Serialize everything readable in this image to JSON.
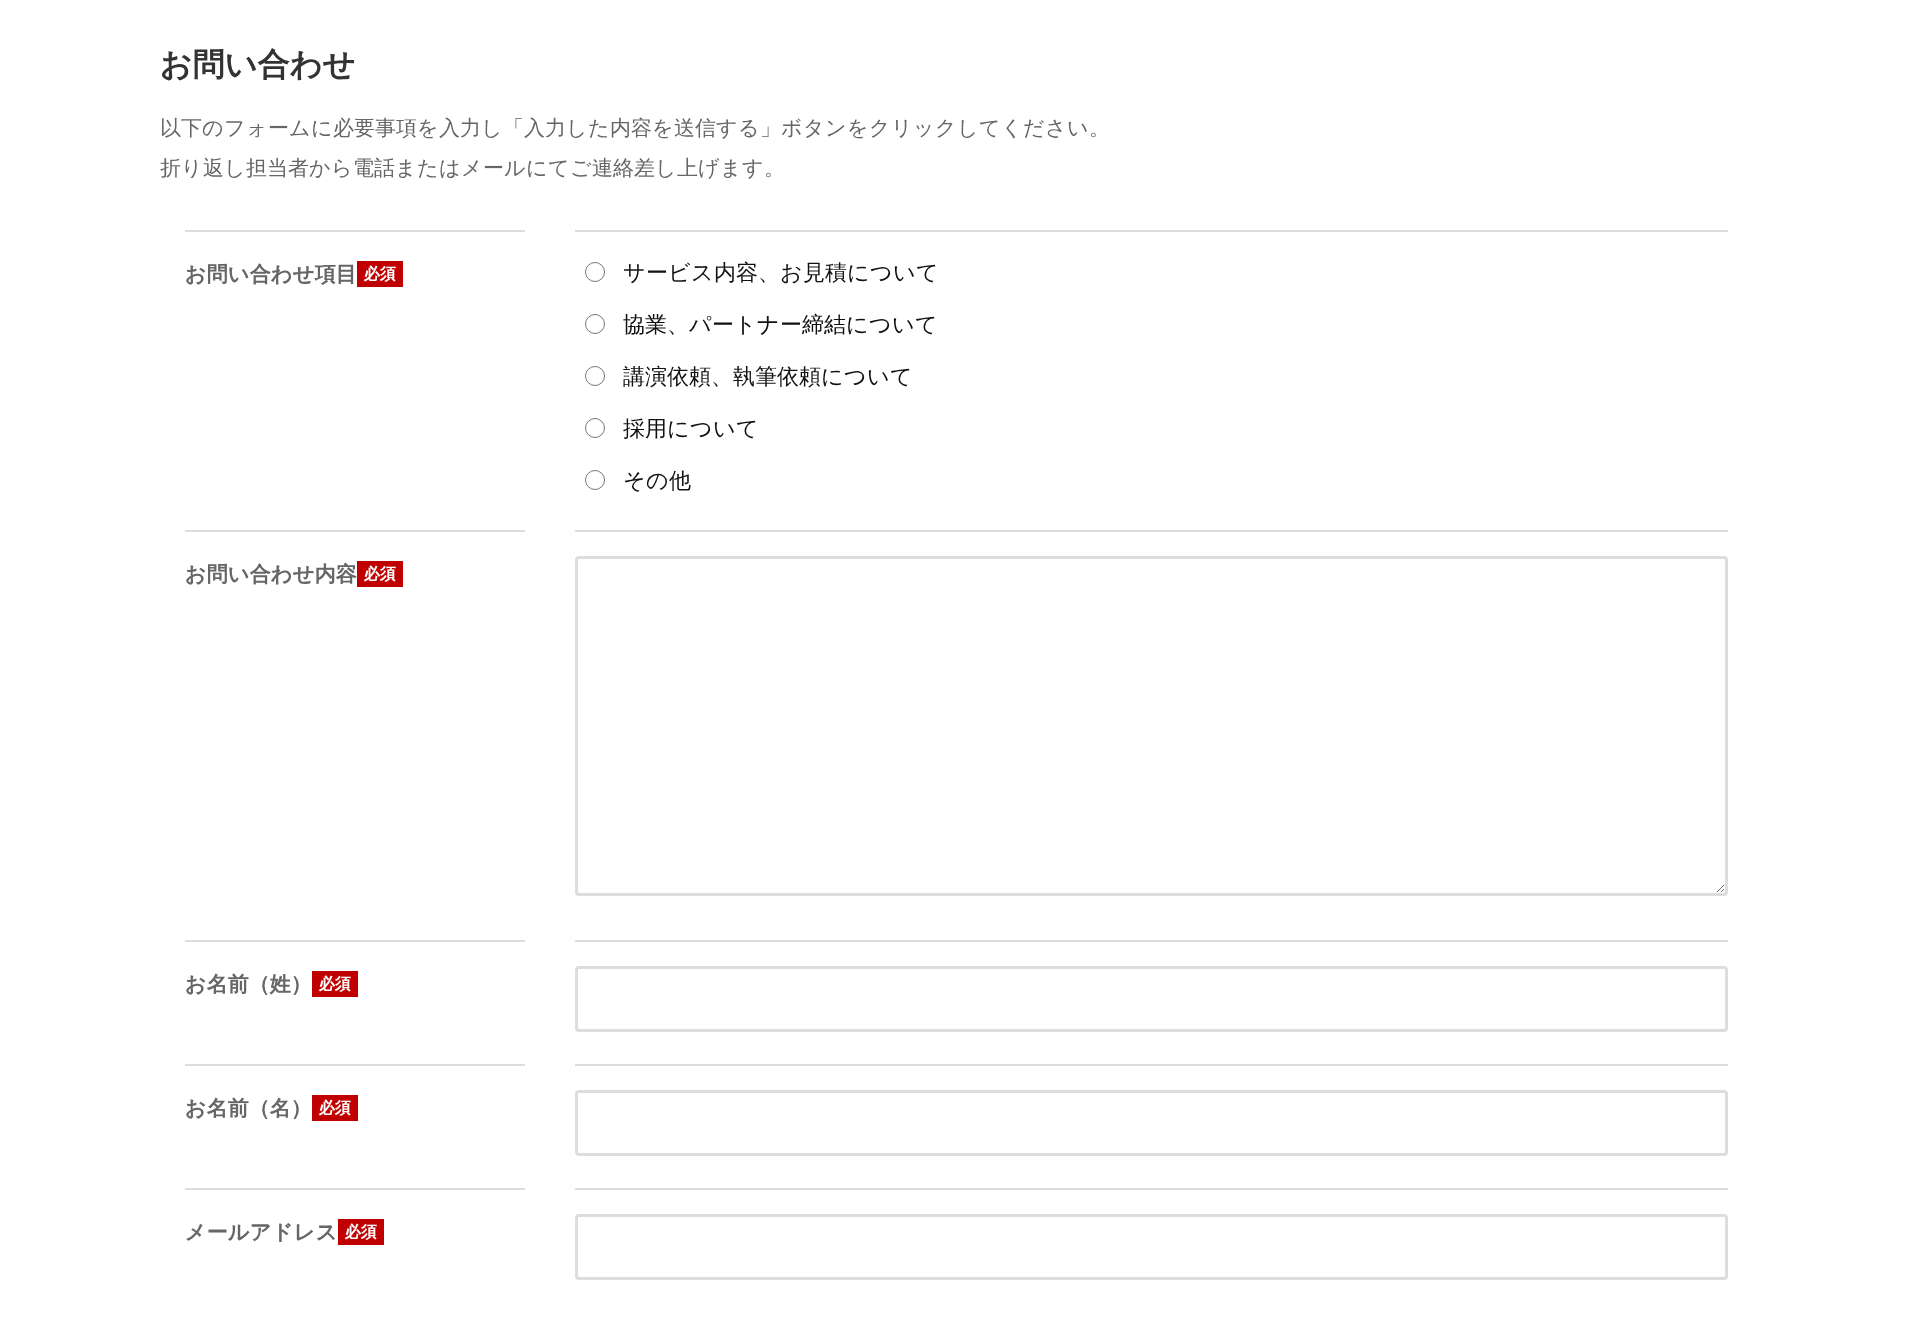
{
  "title": "お問い合わせ",
  "description": [
    "以下のフォームに必要事項を入力し「入力した内容を送信する」ボタンをクリックしてください。",
    "折り返し担当者から電話またはメールにてご連絡差し上げます。"
  ],
  "fields": [
    {
      "kind": "radio",
      "label": "お問い合わせ項目",
      "badge": "必須",
      "options": [
        {
          "label": "サービス内容、お見積について",
          "selected": false
        },
        {
          "label": "協業、パートナー締結について",
          "selected": false
        },
        {
          "label": "講演依頼、執筆依頼について",
          "selected": false
        },
        {
          "label": "採用について",
          "selected": false
        },
        {
          "label": "その他",
          "selected": false
        }
      ]
    },
    {
      "kind": "textarea",
      "label": "お問い合わせ内容",
      "badge": "必須"
    },
    {
      "kind": "text",
      "label": "お名前（姓）",
      "badge": "必須"
    },
    {
      "kind": "text",
      "label": "お名前（名）",
      "badge": "必須"
    },
    {
      "kind": "text",
      "label": "メールアドレス",
      "badge": "必須"
    }
  ]
}
